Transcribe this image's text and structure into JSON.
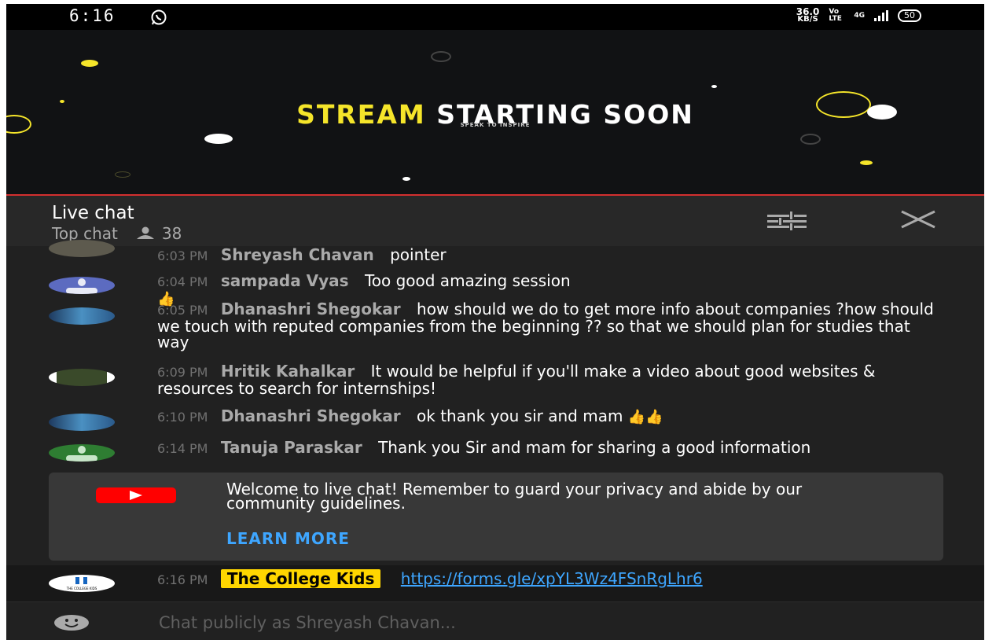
{
  "status_bar": {
    "time": "6:16",
    "net_speed": "36.0",
    "net_unit": "KB/S",
    "volte": "Vo LTE",
    "network": "4G",
    "battery": "50"
  },
  "video": {
    "title_part1": "STREAM",
    "title_part2": "STARTING SOON",
    "subtitle": "SPEAK TO INSPIRE"
  },
  "chat_header": {
    "title": "Live chat",
    "mode": "Top chat",
    "viewer_count": "38"
  },
  "messages": [
    {
      "time": "6:03 PM",
      "author": "Shreyash Chavan",
      "text": "pointer"
    },
    {
      "time": "6:04 PM",
      "author": "sampada Vyas",
      "text": "Too good amazing session",
      "emoji": "👍"
    },
    {
      "time": "6:05 PM",
      "author": "Dhanashri Shegokar",
      "text": "how should we do to get more info about companies ?how should we touch with reputed companies from the beginning ?? so that we should plan for studies that way"
    },
    {
      "time": "6:09 PM",
      "author": "Hritik Kahalkar",
      "text": "It would be helpful if you'll make a video about good websites & resources to search for internships!"
    },
    {
      "time": "6:10 PM",
      "author": "Dhanashri Shegokar",
      "text": "ok thank you sir and mam",
      "emoji": "👍👍"
    },
    {
      "time": "6:14 PM",
      "author": "Tanuja Paraskar",
      "text": "Thank you Sir and mam for sharing a good information"
    }
  ],
  "welcome": {
    "text": "Welcome to live chat! Remember to guard your privacy and abide by our community guidelines.",
    "learn_more": "LEARN MORE"
  },
  "pinned": {
    "time": "6:16 PM",
    "author": "The College Kids",
    "link": "https://forms.gle/xpYL3Wz4FSnRgLhr6",
    "avatar_text": "THE COLLEGE KIDS"
  },
  "input": {
    "placeholder": "Chat publicly as Shreyash Chavan..."
  },
  "colors": {
    "accent_red": "#ff0000",
    "link_blue": "#3ea6ff",
    "owner_badge": "#ffd600",
    "title_yellow": "#f5e52a"
  }
}
